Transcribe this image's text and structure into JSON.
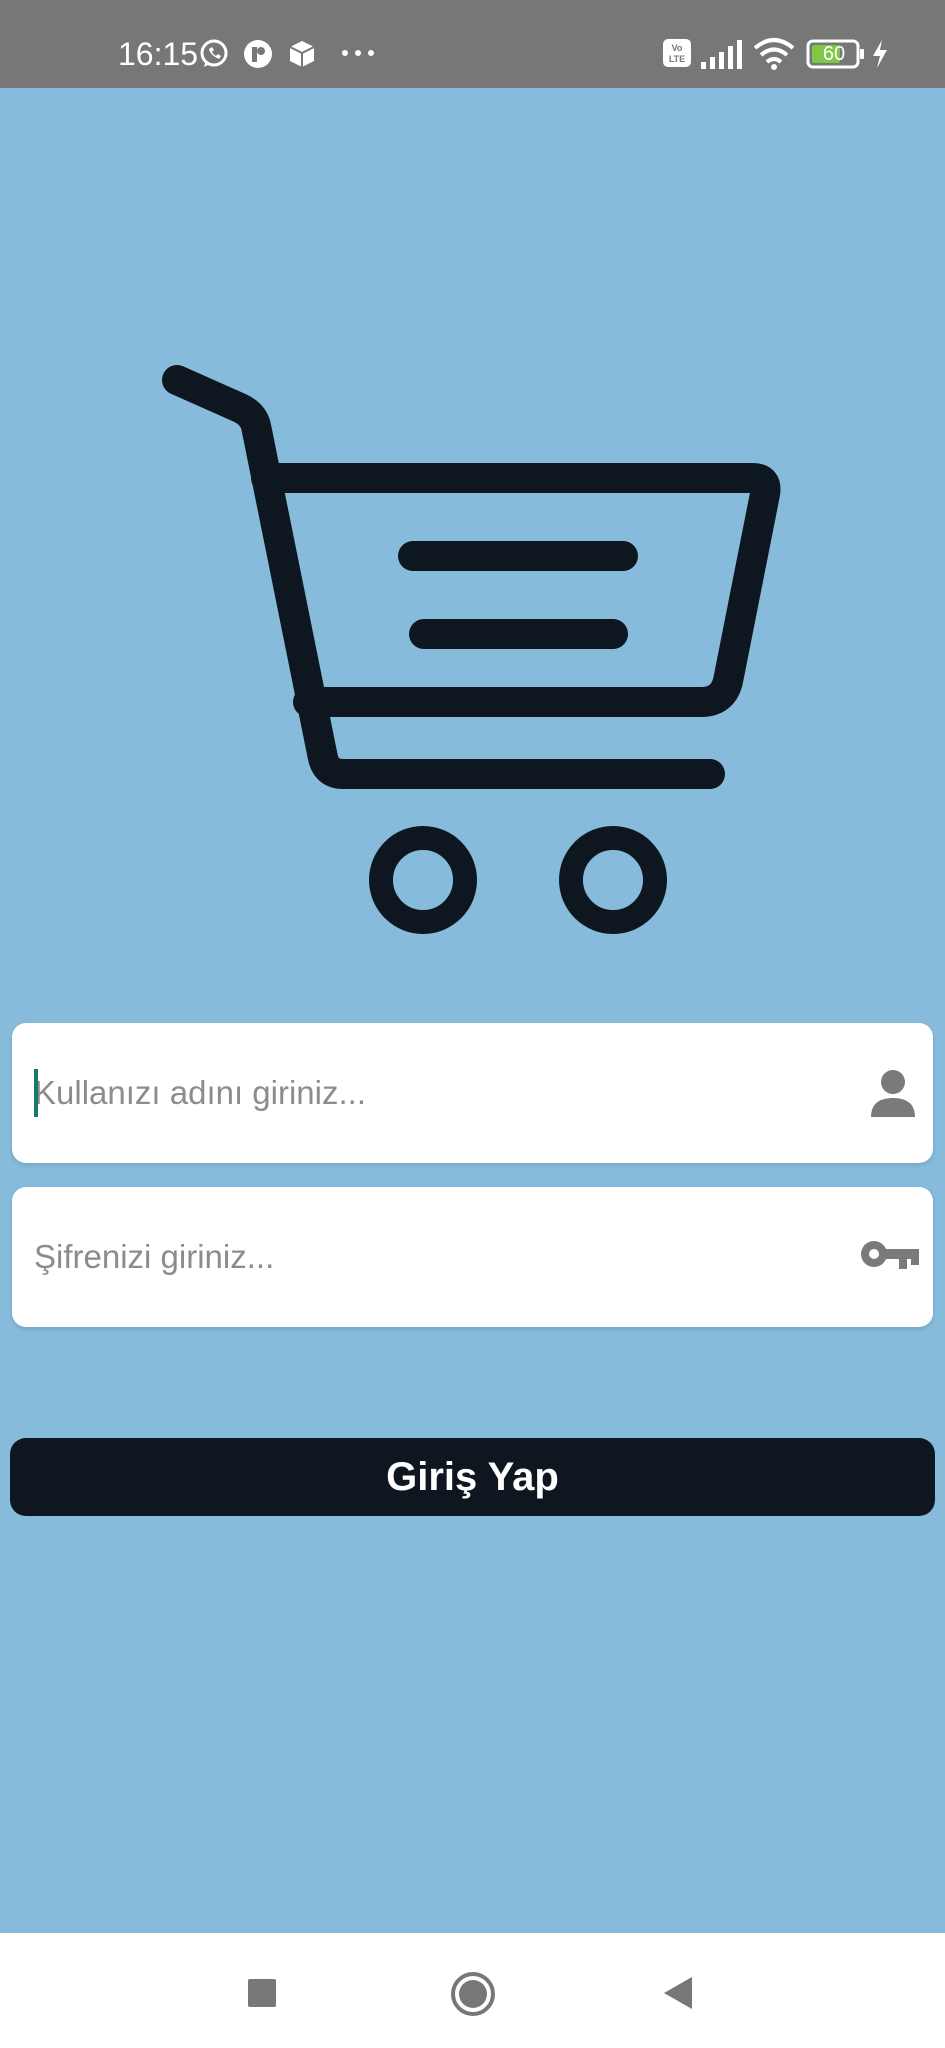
{
  "status_bar": {
    "time": "16:15",
    "battery_level": "60",
    "network_badge": "Vo LTE",
    "icons": [
      "whatsapp-icon",
      "app-notification-icon",
      "package-icon",
      "more-notifications-icon",
      "volte-icon",
      "signal-icon",
      "wifi-icon",
      "battery-icon",
      "charging-icon"
    ]
  },
  "logo": {
    "icon": "shopping-cart-icon",
    "color": "#0e1720"
  },
  "login_form": {
    "username": {
      "value": "",
      "placeholder": "Kullanızı adını giriniz...",
      "icon": "person-icon"
    },
    "password": {
      "value": "",
      "placeholder": "Şifrenizi giriniz...",
      "icon": "key-icon"
    },
    "submit_label": "Giriş Yap"
  },
  "navigation_bar": {
    "buttons": [
      "recents-square-icon",
      "home-circle-icon",
      "back-triangle-icon"
    ]
  },
  "colors": {
    "background": "#86bbdb",
    "status_bar": "#777777",
    "button": "#0e1720",
    "button_text": "#ffffff",
    "caret": "#16796f",
    "icon_gray": "#7a7a7a"
  }
}
